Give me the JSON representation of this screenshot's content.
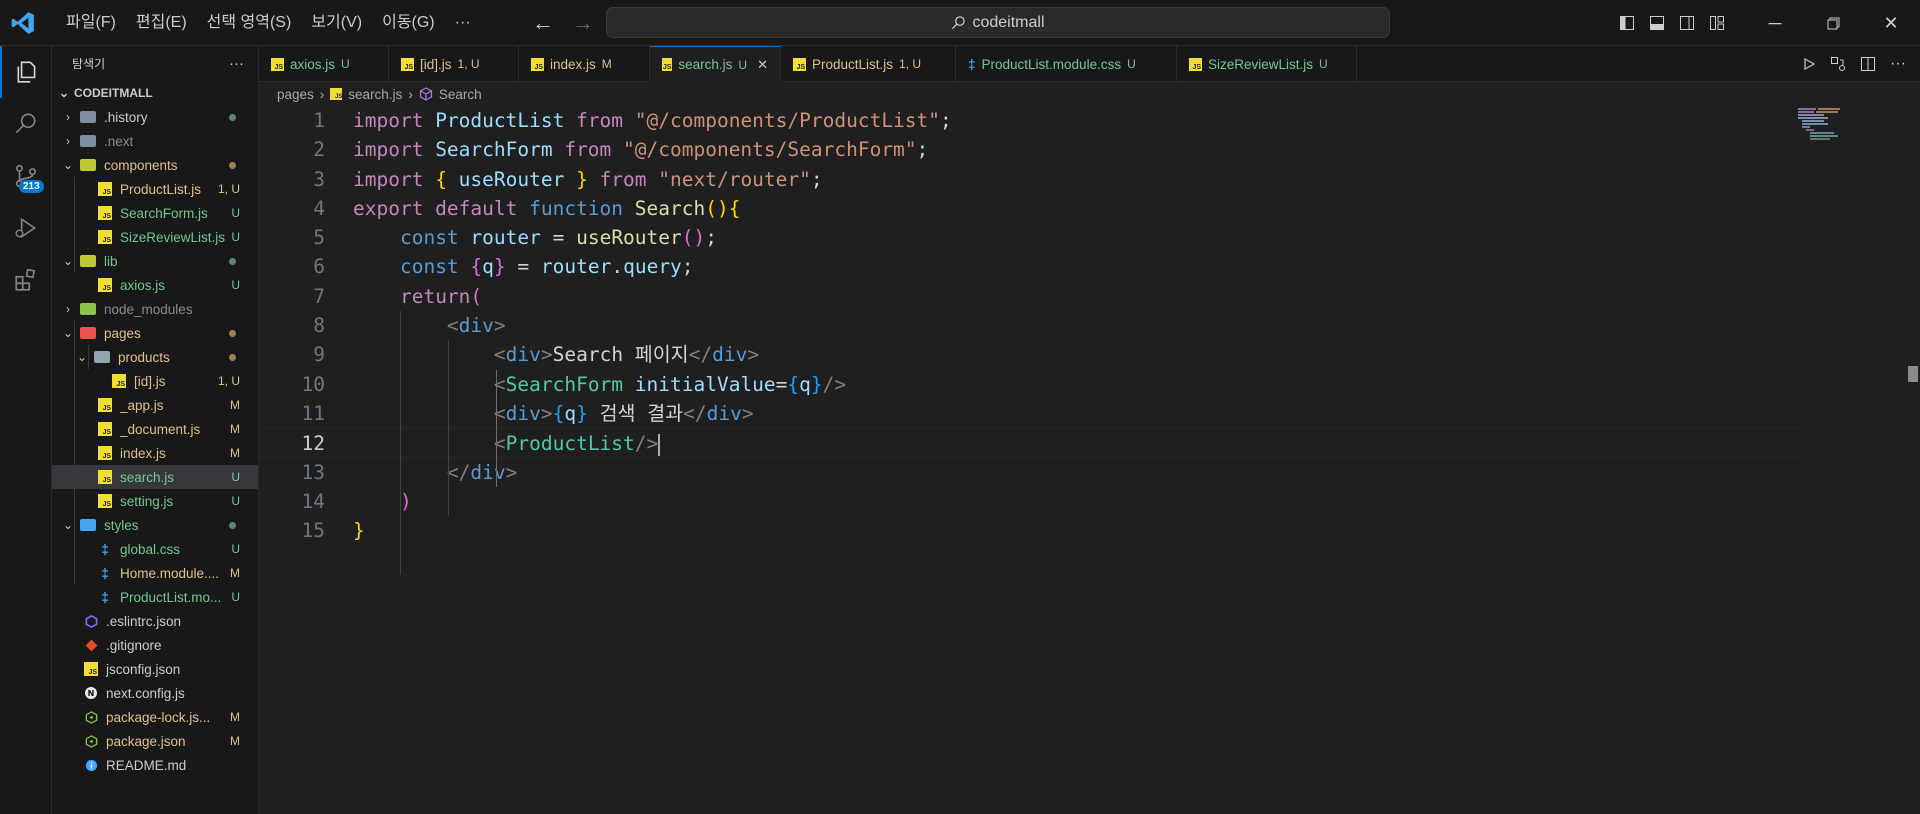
{
  "menu": [
    "파일(F)",
    "편집(E)",
    "선택 영역(S)",
    "보기(V)",
    "이동(G)",
    "···"
  ],
  "search": {
    "text": "codeitmall"
  },
  "sidebar": {
    "title": "탐색기",
    "more": "···",
    "root": "CODEITMALL",
    "rows": [
      {
        "label": ".history",
        "type": "folder",
        "chev": "›",
        "depth": 1,
        "color": "c-w",
        "status": "",
        "dot": "#5a8a6a",
        "folderColor": "#7e8e9e"
      },
      {
        "label": ".next",
        "type": "folder",
        "chev": "›",
        "depth": 1,
        "color": "c-g",
        "status": "",
        "dot": "",
        "folderColor": "#7e8e9e"
      },
      {
        "label": "components",
        "type": "folder",
        "chev": "⌄",
        "depth": 1,
        "color": "c-m",
        "status": "",
        "dot": "#a08050",
        "folderColor": "#c0ca33"
      },
      {
        "label": "ProductList.js",
        "type": "js",
        "depth": 2,
        "color": "c-m",
        "status": "1, U",
        "statusColor": "c-m"
      },
      {
        "label": "SearchForm.js",
        "type": "js",
        "depth": 2,
        "color": "c-u",
        "status": "U",
        "statusColor": "c-u"
      },
      {
        "label": "SizeReviewList.js",
        "type": "js",
        "depth": 2,
        "color": "c-u",
        "status": "U",
        "statusColor": "c-u"
      },
      {
        "label": "lib",
        "type": "folder",
        "chev": "⌄",
        "depth": 1,
        "color": "c-u",
        "status": "",
        "dot": "#5a8a6a",
        "folderColor": "#c0ca33"
      },
      {
        "label": "axios.js",
        "type": "js",
        "depth": 2,
        "color": "c-u",
        "status": "U",
        "statusColor": "c-u"
      },
      {
        "label": "node_modules",
        "type": "folder",
        "chev": "›",
        "depth": 1,
        "color": "c-g",
        "status": "",
        "dot": "",
        "folderColor": "#8bc34a"
      },
      {
        "label": "pages",
        "type": "folder",
        "chev": "⌄",
        "depth": 1,
        "color": "c-m",
        "status": "",
        "dot": "#a08050",
        "folderColor": "#ef5350"
      },
      {
        "label": "products",
        "type": "folder",
        "chev": "⌄",
        "depth": 2,
        "color": "c-m",
        "status": "",
        "dot": "#a08050",
        "folderColor": "#90a4ae"
      },
      {
        "label": "[id].js",
        "type": "js",
        "depth": 3,
        "color": "c-m",
        "status": "1, U",
        "statusColor": "c-m"
      },
      {
        "label": "_app.js",
        "type": "js",
        "depth": 2,
        "color": "c-m",
        "status": "M",
        "statusColor": "c-m"
      },
      {
        "label": "_document.js",
        "type": "js",
        "depth": 2,
        "color": "c-m",
        "status": "M",
        "statusColor": "c-m"
      },
      {
        "label": "index.js",
        "type": "js",
        "depth": 2,
        "color": "c-m",
        "status": "M",
        "statusColor": "c-m"
      },
      {
        "label": "search.js",
        "type": "js",
        "depth": 2,
        "color": "c-u",
        "status": "U",
        "statusColor": "c-u",
        "selected": true
      },
      {
        "label": "setting.js",
        "type": "js",
        "depth": 2,
        "color": "c-u",
        "status": "U",
        "statusColor": "c-u"
      },
      {
        "label": "styles",
        "type": "folder",
        "chev": "⌄",
        "depth": 1,
        "color": "c-u",
        "status": "",
        "dot": "#5a8a6a",
        "folderColor": "#42a5f5"
      },
      {
        "label": "global.css",
        "type": "css",
        "depth": 2,
        "color": "c-u",
        "status": "U",
        "statusColor": "c-u"
      },
      {
        "label": "Home.module....",
        "type": "css",
        "depth": 2,
        "color": "c-m",
        "status": "M",
        "statusColor": "c-m"
      },
      {
        "label": "ProductList.mo...",
        "type": "css",
        "depth": 2,
        "color": "c-u",
        "status": "U",
        "statusColor": "c-u"
      },
      {
        "label": ".eslintrc.json",
        "type": "eslint",
        "depth": 1,
        "color": "c-w",
        "status": ""
      },
      {
        "label": ".gitignore",
        "type": "git",
        "depth": 1,
        "color": "c-w",
        "status": ""
      },
      {
        "label": "jsconfig.json",
        "type": "jsconfig",
        "depth": 1,
        "color": "c-w",
        "status": ""
      },
      {
        "label": "next.config.js",
        "type": "next",
        "depth": 1,
        "color": "c-w",
        "status": ""
      },
      {
        "label": "package-lock.js...",
        "type": "npm",
        "depth": 1,
        "color": "c-m",
        "status": "M",
        "statusColor": "c-m"
      },
      {
        "label": "package.json",
        "type": "npm",
        "depth": 1,
        "color": "c-m",
        "status": "M",
        "statusColor": "c-m"
      },
      {
        "label": "README.md",
        "type": "info",
        "depth": 1,
        "color": "c-w",
        "status": ""
      }
    ]
  },
  "activity": {
    "badge": "213"
  },
  "tabs": [
    {
      "name": "axios.js",
      "status": "U",
      "type": "js",
      "color": "c-u",
      "width": 130
    },
    {
      "name": "[id].js",
      "status": "1, U",
      "type": "js",
      "color": "c-m",
      "width": 130
    },
    {
      "name": "index.js",
      "status": "M",
      "type": "js",
      "color": "c-m",
      "width": 131
    },
    {
      "name": "search.js",
      "status": "U",
      "type": "js",
      "color": "c-u",
      "width": 131,
      "active": true
    },
    {
      "name": "ProductList.js",
      "status": "1, U",
      "type": "js",
      "color": "c-m",
      "width": 175
    },
    {
      "name": "ProductList.module.css",
      "status": "U",
      "type": "css",
      "color": "c-u",
      "width": 221
    },
    {
      "name": "SizeReviewList.js",
      "status": "U",
      "type": "js",
      "color": "c-u",
      "width": 180
    }
  ],
  "breadcrumb": [
    "pages",
    "search.js",
    "Search"
  ],
  "code": [
    [
      [
        "k",
        "import "
      ],
      [
        "v",
        "ProductList "
      ],
      [
        "k",
        "from "
      ],
      [
        "s",
        "\"@/components/ProductList\""
      ],
      [
        "pl",
        ";"
      ]
    ],
    [
      [
        "k",
        "import "
      ],
      [
        "v",
        "SearchForm "
      ],
      [
        "k",
        "from "
      ],
      [
        "s",
        "\"@/components/SearchForm\""
      ],
      [
        "pl",
        ";"
      ]
    ],
    [
      [
        "k",
        "import "
      ],
      [
        "p1",
        "{ "
      ],
      [
        "v",
        "useRouter "
      ],
      [
        "p1",
        "} "
      ],
      [
        "k",
        "from "
      ],
      [
        "s",
        "\"next/router\""
      ],
      [
        "pl",
        ";"
      ]
    ],
    [
      [
        "k",
        "export default "
      ],
      [
        "kb",
        "function "
      ],
      [
        "f",
        "Search"
      ],
      [
        "p1",
        "(){"
      ]
    ],
    [
      [
        "pl",
        "    "
      ],
      [
        "kb",
        "const "
      ],
      [
        "v",
        "router "
      ],
      [
        "pl",
        "= "
      ],
      [
        "f",
        "useRouter"
      ],
      [
        "p2",
        "()"
      ],
      [
        "pl",
        ";"
      ]
    ],
    [
      [
        "pl",
        "    "
      ],
      [
        "kb",
        "const "
      ],
      [
        "p2",
        "{"
      ],
      [
        "v",
        "q"
      ],
      [
        "p2",
        "} "
      ],
      [
        "pl",
        "= "
      ],
      [
        "v",
        "router"
      ],
      [
        "pl",
        "."
      ],
      [
        "v",
        "query"
      ],
      [
        "pl",
        ";"
      ]
    ],
    [
      [
        "pl",
        "    "
      ],
      [
        "k",
        "return"
      ],
      [
        "p2",
        "("
      ]
    ],
    [
      [
        "pl",
        "        "
      ],
      [
        "tgb",
        "<"
      ],
      [
        "tg",
        "div"
      ],
      [
        "tgb",
        ">"
      ]
    ],
    [
      [
        "pl",
        "            "
      ],
      [
        "tgb",
        "<"
      ],
      [
        "tg",
        "div"
      ],
      [
        "tgb",
        ">"
      ],
      [
        "pl",
        "Search 페이지"
      ],
      [
        "tgb",
        "</"
      ],
      [
        "tg",
        "div"
      ],
      [
        "tgb",
        ">"
      ]
    ],
    [
      [
        "pl",
        "            "
      ],
      [
        "tgb",
        "<"
      ],
      [
        "t",
        "SearchForm "
      ],
      [
        "v",
        "initialValue"
      ],
      [
        "pl",
        "="
      ],
      [
        "p3",
        "{"
      ],
      [
        "v",
        "q"
      ],
      [
        "p3",
        "}"
      ],
      [
        "tgb",
        "/>"
      ]
    ],
    [
      [
        "pl",
        "            "
      ],
      [
        "tgb",
        "<"
      ],
      [
        "tg",
        "div"
      ],
      [
        "tgb",
        ">"
      ],
      [
        "p3",
        "{"
      ],
      [
        "v",
        "q"
      ],
      [
        "p3",
        "}"
      ],
      [
        "pl",
        " 검색 결과"
      ],
      [
        "tgb",
        "</"
      ],
      [
        "tg",
        "div"
      ],
      [
        "tgb",
        ">"
      ]
    ],
    [
      [
        "pl",
        "            "
      ],
      [
        "tgb",
        "<"
      ],
      [
        "t",
        "ProductList"
      ],
      [
        "tgb",
        "/>"
      ]
    ],
    [
      [
        "pl",
        "        "
      ],
      [
        "tgb",
        "</"
      ],
      [
        "tg",
        "div"
      ],
      [
        "tgb",
        ">"
      ]
    ],
    [
      [
        "pl",
        "    "
      ],
      [
        "p2",
        ")"
      ]
    ],
    [
      [
        "p1",
        "}"
      ]
    ]
  ],
  "current_line": 12,
  "colors": {
    "accent": "#0078d4",
    "untracked": "#73c991",
    "modified": "#e2c08d"
  }
}
